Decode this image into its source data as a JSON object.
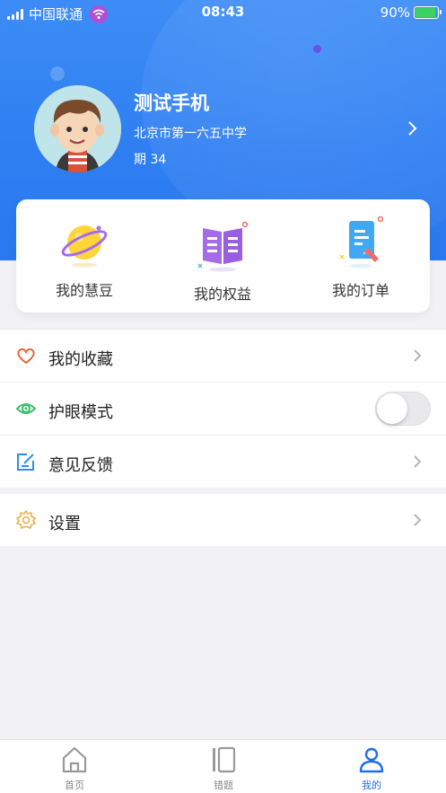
{
  "status_bar": {
    "carrier": "中国联通",
    "time": "08:43",
    "battery": "90%",
    "battery_level": 0.9
  },
  "profile": {
    "name": "测试手机",
    "school": "北京市第一六五中学",
    "period": "期 34"
  },
  "cards": [
    {
      "label": "我的慧豆",
      "icon": "planet-icon"
    },
    {
      "label": "我的权益",
      "icon": "book-icon"
    },
    {
      "label": "我的订单",
      "icon": "order-icon"
    }
  ],
  "menu": [
    {
      "label": "我的收藏",
      "icon": "heart-icon",
      "control": "chevron"
    },
    {
      "label": "护眼模式",
      "icon": "eye-icon",
      "control": "toggle",
      "toggle_on": false
    },
    {
      "label": "意见反馈",
      "icon": "feedback-icon",
      "control": "chevron"
    }
  ],
  "settings": {
    "label": "设置",
    "icon": "gear-icon"
  },
  "tabs": [
    {
      "label": "首页",
      "icon": "home-icon",
      "active": false
    },
    {
      "label": "错题",
      "icon": "mistakes-icon",
      "active": false
    },
    {
      "label": "我的",
      "icon": "user-icon",
      "active": true
    }
  ],
  "colors": {
    "header_blue": "#2f7ff2",
    "active_tab": "#1f6fe8",
    "heart": "#e8663d",
    "eye": "#3bbf6a",
    "feedback": "#2d8bf0",
    "gear": "#e9b04a"
  }
}
